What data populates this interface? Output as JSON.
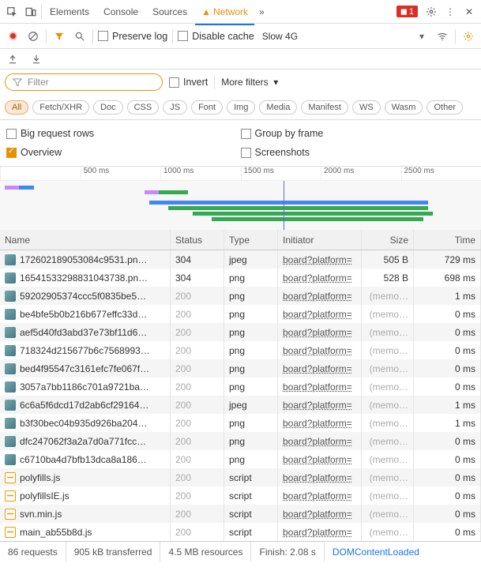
{
  "top": {
    "tabs": [
      "Elements",
      "Console",
      "Sources",
      "Network"
    ],
    "active": 3,
    "more": "»",
    "error_badge": "1"
  },
  "toolbar": {
    "preserve_log": "Preserve log",
    "disable_cache": "Disable cache",
    "throttle": "Slow 4G"
  },
  "filter": {
    "placeholder": "Filter",
    "invert": "Invert",
    "more_filters": "More filters"
  },
  "pills": [
    "All",
    "Fetch/XHR",
    "Doc",
    "CSS",
    "JS",
    "Font",
    "Img",
    "Media",
    "Manifest",
    "WS",
    "Wasm",
    "Other"
  ],
  "options": {
    "big_rows": "Big request rows",
    "overview": "Overview",
    "group_frame": "Group by frame",
    "screenshots": "Screenshots"
  },
  "timeline": {
    "ticks": [
      "",
      "500 ms",
      "1000 ms",
      "1500 ms",
      "2000 ms",
      "2500 ms"
    ]
  },
  "columns": {
    "name": "Name",
    "status": "Status",
    "type": "Type",
    "initiator": "Initiator",
    "size": "Size",
    "time": "Time"
  },
  "rows": [
    {
      "ico": "img",
      "name": "172602189053084c9531.pn…",
      "status": "304",
      "dim": false,
      "type": "jpeg",
      "init": "board?platform=",
      "size": "505 B",
      "sizeDim": false,
      "time": "729 ms"
    },
    {
      "ico": "img",
      "name": "16541533298831043738.pn…",
      "status": "304",
      "dim": false,
      "type": "png",
      "init": "board?platform=",
      "size": "528 B",
      "sizeDim": false,
      "time": "698 ms"
    },
    {
      "ico": "img",
      "name": "59202905374ccc5f0835be5…",
      "status": "200",
      "dim": true,
      "type": "png",
      "init": "board?platform=",
      "size": "(memo…",
      "sizeDim": true,
      "time": "1 ms"
    },
    {
      "ico": "img",
      "name": "be4bfe5b0b216b677effc33d…",
      "status": "200",
      "dim": true,
      "type": "png",
      "init": "board?platform=",
      "size": "(memo…",
      "sizeDim": true,
      "time": "0 ms"
    },
    {
      "ico": "img",
      "name": "aef5d40fd3abd37e73bf11d6…",
      "status": "200",
      "dim": true,
      "type": "png",
      "init": "board?platform=",
      "size": "(memo…",
      "sizeDim": true,
      "time": "0 ms"
    },
    {
      "ico": "img",
      "name": "718324d215677b6c7568993…",
      "status": "200",
      "dim": true,
      "type": "png",
      "init": "board?platform=",
      "size": "(memo…",
      "sizeDim": true,
      "time": "0 ms"
    },
    {
      "ico": "img",
      "name": "bed4f95547c3161efc7fe067f…",
      "status": "200",
      "dim": true,
      "type": "png",
      "init": "board?platform=",
      "size": "(memo…",
      "sizeDim": true,
      "time": "0 ms"
    },
    {
      "ico": "img",
      "name": "3057a7bb1186c701a9721ba…",
      "status": "200",
      "dim": true,
      "type": "png",
      "init": "board?platform=",
      "size": "(memo…",
      "sizeDim": true,
      "time": "0 ms"
    },
    {
      "ico": "img",
      "name": "6c6a5f6dcd17d2ab6cf29164…",
      "status": "200",
      "dim": true,
      "type": "jpeg",
      "init": "board?platform=",
      "size": "(memo…",
      "sizeDim": true,
      "time": "1 ms"
    },
    {
      "ico": "img",
      "name": "b3f30bec04b935d926ba204…",
      "status": "200",
      "dim": true,
      "type": "png",
      "init": "board?platform=",
      "size": "(memo…",
      "sizeDim": true,
      "time": "1 ms"
    },
    {
      "ico": "img",
      "name": "dfc247062f3a2a7d0a771fcc…",
      "status": "200",
      "dim": true,
      "type": "png",
      "init": "board?platform=",
      "size": "(memo…",
      "sizeDim": true,
      "time": "0 ms"
    },
    {
      "ico": "img",
      "name": "c6710ba4d7bfb13dca8a186…",
      "status": "200",
      "dim": true,
      "type": "png",
      "init": "board?platform=",
      "size": "(memo…",
      "sizeDim": true,
      "time": "0 ms"
    },
    {
      "ico": "js",
      "name": "polyfills.js",
      "status": "200",
      "dim": true,
      "type": "script",
      "init": "board?platform=",
      "size": "(memo…",
      "sizeDim": true,
      "time": "0 ms"
    },
    {
      "ico": "js",
      "name": "polyfillsIE.js",
      "status": "200",
      "dim": true,
      "type": "script",
      "init": "board?platform=",
      "size": "(memo…",
      "sizeDim": true,
      "time": "0 ms"
    },
    {
      "ico": "js",
      "name": "svn.min.js",
      "status": "200",
      "dim": true,
      "type": "script",
      "init": "board?platform=",
      "size": "(memo…",
      "sizeDim": true,
      "time": "0 ms"
    },
    {
      "ico": "js",
      "name": "main_ab55b8d.js",
      "status": "200",
      "dim": true,
      "type": "script",
      "init": "board?platform=",
      "size": "(memo…",
      "sizeDim": true,
      "time": "0 ms"
    }
  ],
  "status": {
    "requests": "86 requests",
    "transferred": "905 kB transferred",
    "resources": "4.5 MB resources",
    "finish": "Finish: 2.08 s",
    "dcl": "DOMContentLoaded"
  }
}
